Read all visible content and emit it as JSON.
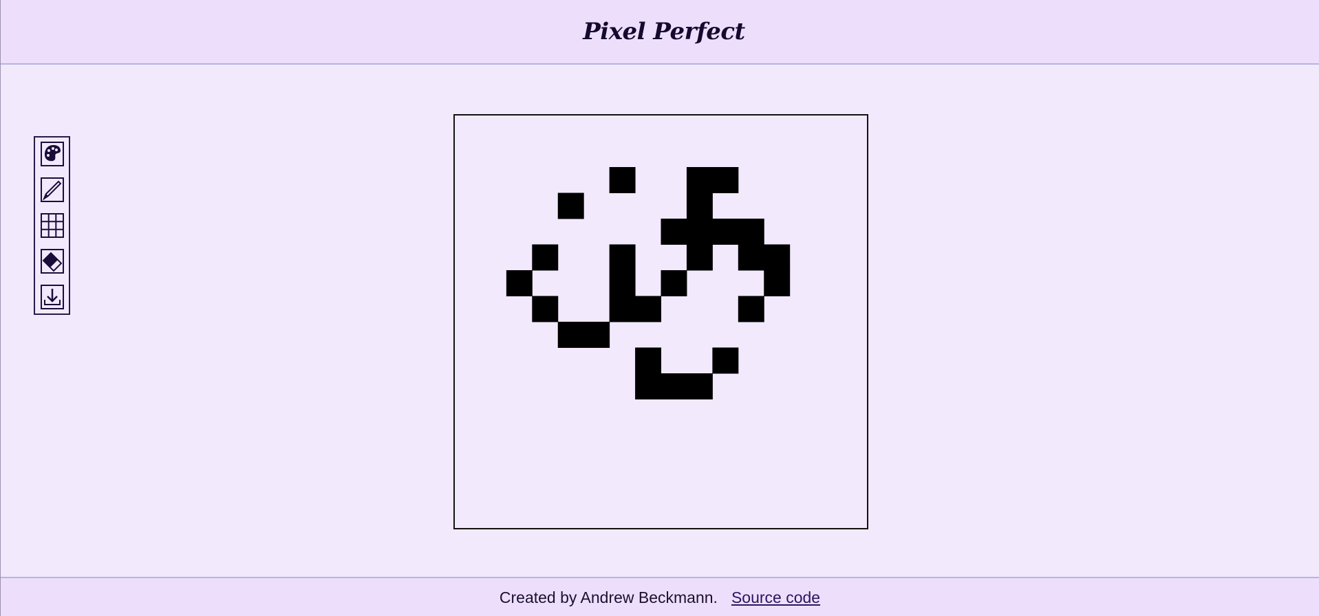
{
  "header": {
    "title": "Pixel Perfect"
  },
  "toolbar": {
    "tools": [
      {
        "name": "color-palette",
        "icon": "palette-icon"
      },
      {
        "name": "pencil",
        "icon": "pencil-icon"
      },
      {
        "name": "grid",
        "icon": "grid-icon"
      },
      {
        "name": "eraser",
        "icon": "eraser-icon"
      },
      {
        "name": "download",
        "icon": "download-icon"
      }
    ]
  },
  "canvas": {
    "grid_size": 16,
    "fill_color": "#000000",
    "filled_cells": [
      [
        2,
        6
      ],
      [
        3,
        4
      ],
      [
        2,
        9
      ],
      [
        2,
        10
      ],
      [
        3,
        9
      ],
      [
        4,
        8
      ],
      [
        4,
        9
      ],
      [
        4,
        10
      ],
      [
        4,
        11
      ],
      [
        5,
        3
      ],
      [
        5,
        6
      ],
      [
        5,
        9
      ],
      [
        5,
        11
      ],
      [
        5,
        12
      ],
      [
        6,
        2
      ],
      [
        6,
        6
      ],
      [
        6,
        8
      ],
      [
        6,
        12
      ],
      [
        7,
        3
      ],
      [
        7,
        6
      ],
      [
        7,
        7
      ],
      [
        7,
        11
      ],
      [
        8,
        4
      ],
      [
        8,
        5
      ],
      [
        9,
        7
      ],
      [
        9,
        10
      ],
      [
        10,
        7
      ],
      [
        10,
        8
      ],
      [
        10,
        9
      ]
    ]
  },
  "footer": {
    "credit": "Created by Andrew Beckmann.",
    "source_link": "Source code"
  }
}
